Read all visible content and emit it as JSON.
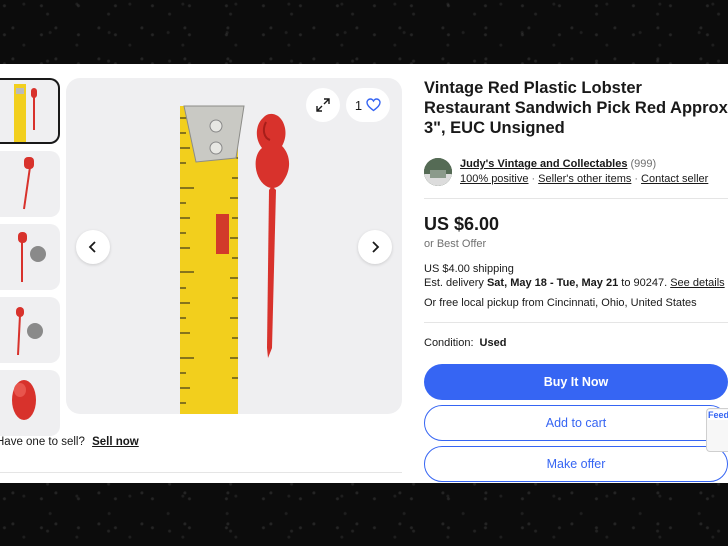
{
  "listing": {
    "title": "Vintage Red Plastic Lobster Restaurant Sandwich Pick Red Approx 3\", EUC Unsigned"
  },
  "gallery": {
    "watch_count": "1"
  },
  "seller": {
    "name": "Judy's Vintage and Collectables",
    "feedback_count": "(999)",
    "positive": "100% positive",
    "other_items": "Seller's other items",
    "contact": "Contact seller"
  },
  "pricing": {
    "price": "US $6.00",
    "best_offer": "or Best Offer",
    "shipping": "US $4.00 shipping",
    "delivery_prefix": "Est. delivery ",
    "delivery_dates": "Sat, May 18 - Tue, May 21",
    "delivery_to": " to 90247. ",
    "see_details": "See details",
    "pickup": "Or free local pickup from Cincinnati, Ohio, United States"
  },
  "condition": {
    "label": "Condition:",
    "value": "Used"
  },
  "actions": {
    "buy_now": "Buy It Now",
    "add_to_cart": "Add to cart",
    "make_offer": "Make offer"
  },
  "sell": {
    "prompt": "Have one to sell?",
    "link": "Sell now"
  },
  "feedback_tab": "Feed",
  "colors": {
    "accent": "#3665f3",
    "text": "#191919",
    "muted": "#707070",
    "lobster_red": "#d8322c",
    "tape_yellow": "#f2cf1d"
  },
  "icons": [
    "expand-icon",
    "heart-icon",
    "chevron-left-icon",
    "chevron-right-icon"
  ]
}
